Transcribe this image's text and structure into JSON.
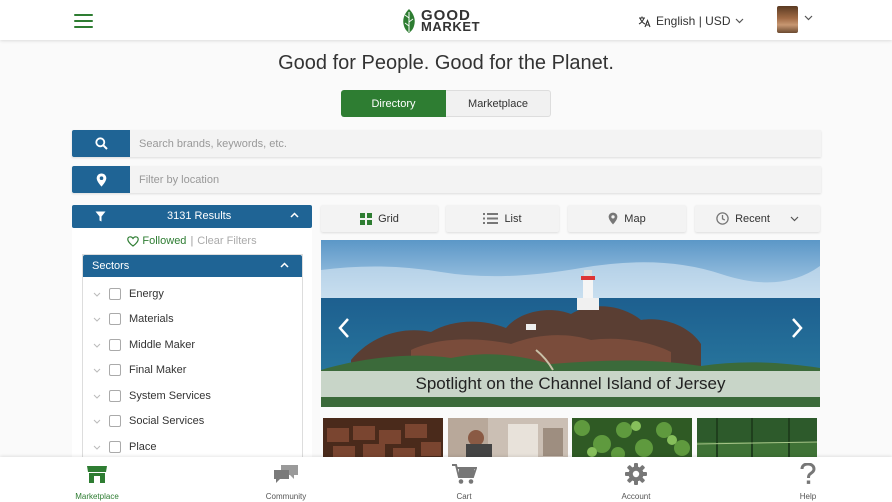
{
  "header": {
    "logo_line1": "GOOD",
    "logo_line2": "MARKET",
    "language_label": "English | USD"
  },
  "tagline": "Good for People. Good for the Planet.",
  "mode_toggle": {
    "directory_label": "Directory",
    "marketplace_label": "Marketplace",
    "active": "Directory"
  },
  "search": {
    "placeholder": "Search brands, keywords, etc.",
    "value": ""
  },
  "location": {
    "placeholder": "Filter by location",
    "value": ""
  },
  "results": {
    "count_label": "3131 Results",
    "followed_label": "Followed",
    "separator": "|",
    "clear_label": "Clear Filters"
  },
  "sectors": {
    "title": "Sectors",
    "items": [
      {
        "label": "Energy"
      },
      {
        "label": "Materials"
      },
      {
        "label": "Middle Maker"
      },
      {
        "label": "Final Maker"
      },
      {
        "label": "System Services"
      },
      {
        "label": "Social Services"
      },
      {
        "label": "Place"
      }
    ]
  },
  "view_options": {
    "grid_label": "Grid",
    "list_label": "List",
    "map_label": "Map",
    "sort_label": "Recent",
    "active": "Grid"
  },
  "carousel": {
    "caption": "Spotlight on the Channel Island of Jersey"
  },
  "bottom_nav": {
    "items": [
      {
        "label": "Marketplace",
        "icon": "store-icon"
      },
      {
        "label": "Community",
        "icon": "chat-bubbles-icon"
      },
      {
        "label": "Cart",
        "icon": "cart-icon"
      },
      {
        "label": "Account",
        "icon": "gear-icon"
      },
      {
        "label": "Help",
        "icon": "question-icon"
      }
    ],
    "active": "Marketplace"
  },
  "colors": {
    "brand_green": "#2e7d32",
    "brand_blue": "#1f6495"
  }
}
